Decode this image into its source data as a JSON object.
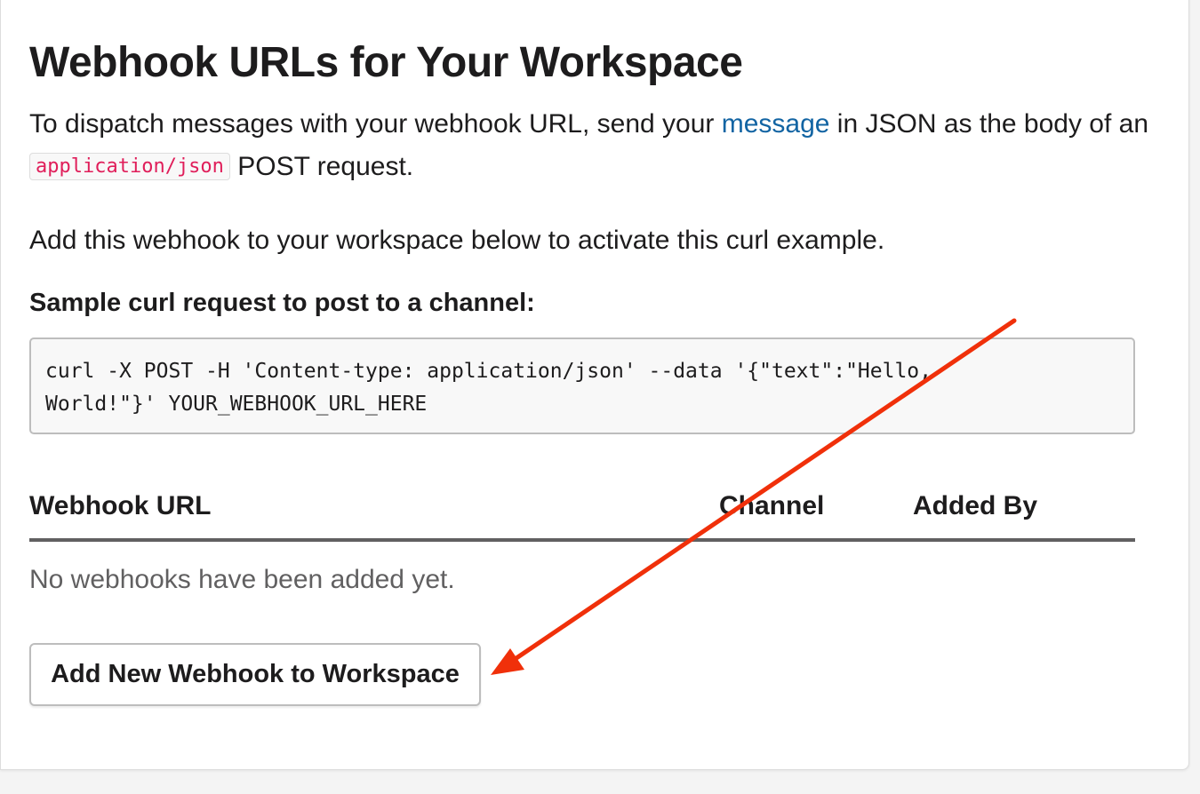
{
  "page": {
    "title": "Webhook URLs for Your Workspace",
    "intro": {
      "part1": "To dispatch messages with your webhook URL, send your ",
      "link": "message",
      "part2": " in JSON as the body of an ",
      "code": "application/json",
      "part3": " POST request."
    },
    "activate_text": "Add this webhook to your workspace below to activate this curl example.",
    "sample_heading": "Sample curl request to post to a channel:",
    "sample_code": "curl -X POST -H 'Content-type: application/json' --data '{\"text\":\"Hello,\nWorld!\"}' YOUR_WEBHOOK_URL_HERE"
  },
  "table": {
    "headers": {
      "webhook_url": "Webhook URL",
      "channel": "Channel",
      "added_by": "Added By"
    },
    "empty_text": "No webhooks have been added yet."
  },
  "actions": {
    "add_button": "Add New Webhook to Workspace"
  },
  "annotation": {
    "arrow_color": "#f0300a"
  },
  "colors": {
    "link": "#1264a3",
    "inline_code": "#e01e5a"
  }
}
